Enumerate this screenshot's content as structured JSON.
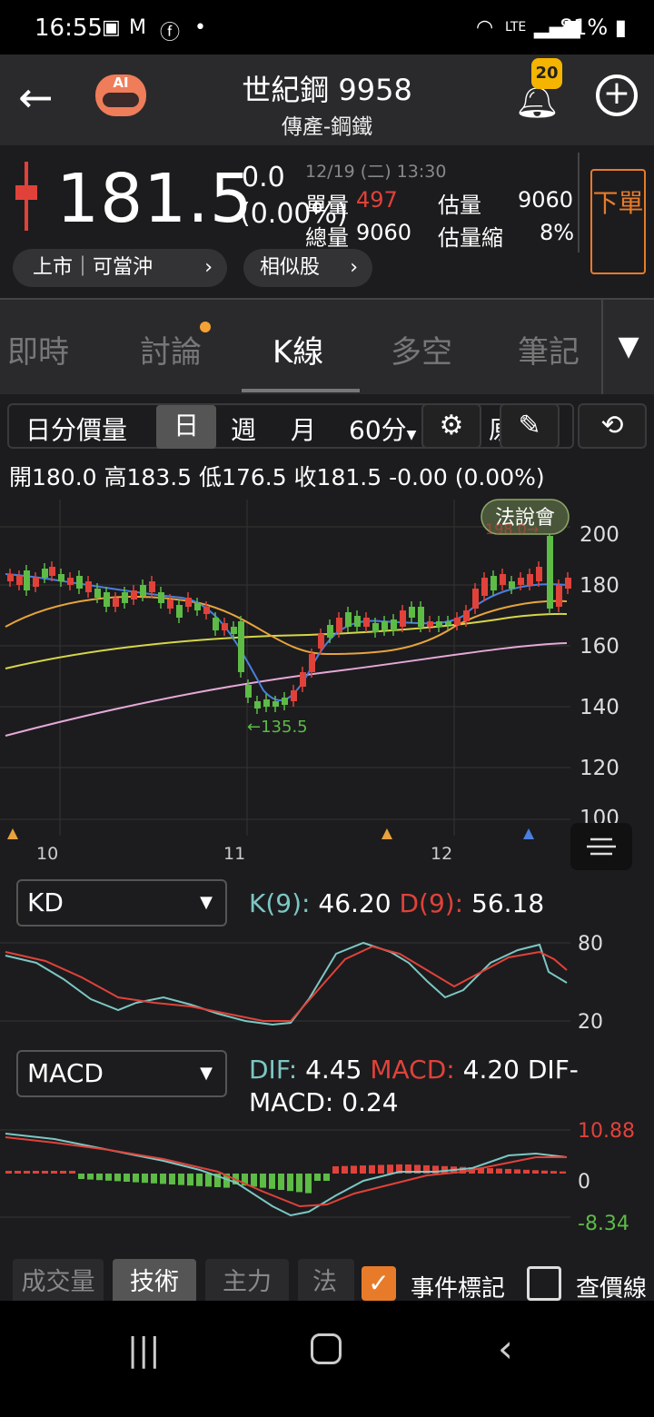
{
  "status": {
    "time": "16:55",
    "battery": "81%"
  },
  "header": {
    "back_icon": "arrow-left-icon",
    "ai_label": "AI",
    "title": "世紀鋼 9958",
    "subtitle": "傳產-鋼鐵",
    "notification_count": "20"
  },
  "quote": {
    "price": "181.5",
    "change": "0.0",
    "change_pct": "(0.00%)",
    "datetime": "12/19 (二) 13:30",
    "single_vol_label": "單量",
    "single_vol": "497",
    "est_vol_label": "估量",
    "est_vol": "9060",
    "total_vol_label": "總量",
    "total_vol": "9060",
    "est_shrink_label": "估量縮",
    "est_shrink": "8%",
    "order_button": "下單",
    "market_pill": "上市｜可當沖",
    "similar_pill": "相似股"
  },
  "tabs": [
    "即時",
    "討論",
    "K線",
    "多空",
    "筆記"
  ],
  "toolbar": {
    "items": [
      "日分價量",
      "日",
      "週",
      "月",
      "60分"
    ],
    "active": "日",
    "partial": "原"
  },
  "ohlc": "開180.0 高183.5 低176.5 收181.5 -0.00 (0.00%)",
  "kline": {
    "event_label": "法說會",
    "high_marker": "198.0→",
    "low_marker": "←135.5",
    "y_ticks": [
      "200",
      "180",
      "160",
      "140",
      "120",
      "100"
    ],
    "x_ticks": [
      "10",
      "11",
      "12"
    ]
  },
  "kd": {
    "selector": "KD",
    "k_label": "K(9):",
    "k_value": "46.20",
    "d_label": "D(9):",
    "d_value": "56.18",
    "ticks": [
      "80",
      "20"
    ]
  },
  "macd": {
    "selector": "MACD",
    "dif_label": "DIF:",
    "dif_value": "4.45",
    "macd_label": "MACD:",
    "macd_value": "4.20",
    "diff_label": "DIF-MACD:",
    "diff_value": "0.24",
    "ticks": [
      "10.88",
      "0",
      "-8.34"
    ]
  },
  "bottom_tabs": [
    "成交量",
    "技術",
    "主力",
    "法人"
  ],
  "bottom_active": "技術",
  "checkboxes": [
    {
      "label": "事件標記",
      "checked": true
    },
    {
      "label": "查價線",
      "checked": false
    }
  ],
  "colors": {
    "up": "#e0423a",
    "down": "#5dbb46",
    "accent": "#e87b2a",
    "ma5": "#4a7fe0",
    "ma20": "#e8a33c",
    "ma60": "#d6d64a",
    "ma240": "#e6a8d8"
  }
}
